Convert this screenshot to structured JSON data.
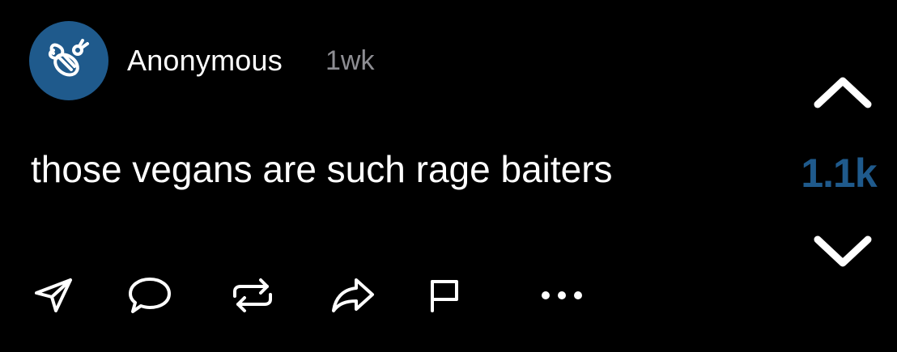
{
  "post": {
    "author": "Anonymous",
    "time": "1wk",
    "text": "those vegans are such rage baiters",
    "score": "1.1k"
  },
  "colors": {
    "background": "#000000",
    "avatar_bg": "#1f5a8c",
    "score": "#1f5a8c",
    "meta": "#8e8e93",
    "text": "#ffffff"
  },
  "icons": {
    "avatar": "bee-icon",
    "upvote": "chevron-up-icon",
    "downvote": "chevron-down-icon",
    "actions": [
      "send-icon",
      "comment-icon",
      "repost-icon",
      "share-icon",
      "flag-icon",
      "more-icon"
    ]
  }
}
